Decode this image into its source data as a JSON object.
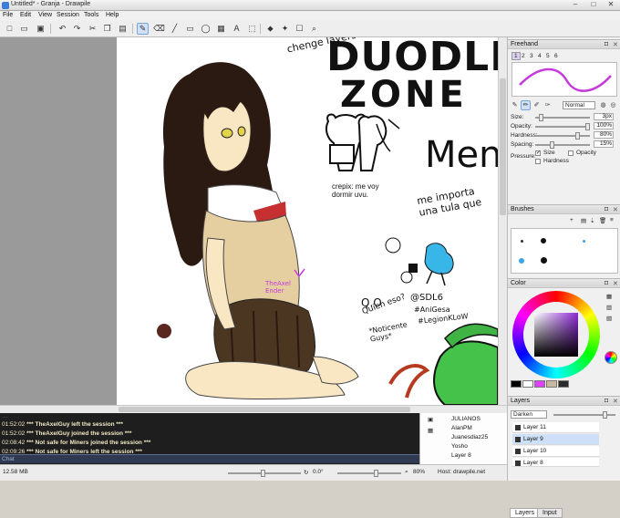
{
  "window": {
    "title": "Untitled* - Granja - Drawpile",
    "controls": [
      "–",
      "□",
      "✕"
    ]
  },
  "menu": [
    "File",
    "Edit",
    "View",
    "Session",
    "Tools",
    "Help"
  ],
  "canvas_text": {
    "dudles": "DUODLES",
    "zone": "ZONE",
    "change_layers": "chenge layers?",
    "crepix": "crepix: me voy\ndormir uvu.",
    "me": "Men",
    "me_importa": "me importa\nuna tula que",
    "sdl6": "@SDL6",
    "anigesa": "#AniGesa",
    "legionklow": "#LegionKLoW",
    "quien_es": "Quien eso?",
    "noticente": "*Noticente\nGuys*",
    "qoo": "Q.O",
    "signature": "TheAxel\nEnder"
  },
  "freehand": {
    "title": "Freehand",
    "presets": [
      "1",
      "2",
      "3",
      "4",
      "5",
      "6"
    ],
    "blend_mode": "Normal",
    "size_label": "Size:",
    "size_value": "3px",
    "opacity_label": "Opacity:",
    "opacity_value": "100%",
    "hardness_label": "Hardness:",
    "hardness_value": "80%",
    "spacing_label": "Spacing:",
    "spacing_value": "15%",
    "pressure_label": "Pressure:",
    "pressure_size": "Size",
    "pressure_opacity": "Opacity",
    "pressure_hardness": "Hardness",
    "stroke_color": "#c43bd9"
  },
  "brushes": {
    "title": "Brushes"
  },
  "color": {
    "title": "Color",
    "current_color": "#5e2a78",
    "swatches": [
      "#000000",
      "#ffffff",
      "#e040fb",
      "#c8b9a0",
      "#2a2a2a"
    ]
  },
  "layers": {
    "title": "Layers",
    "blend_mode": "Darken",
    "items": [
      "Layer 11",
      "Layer 9",
      "Layer 10",
      "Layer 8"
    ],
    "tabs": [
      "Layers",
      "Input"
    ]
  },
  "chat": {
    "lines": [
      {
        "time": "01:52:02",
        "text": "*** TheAxelGuy left the session ***"
      },
      {
        "time": "01:52:02",
        "text": "*** TheAxelGuy joined the session ***"
      },
      {
        "time": "02:08:42",
        "text": "*** Not safe for Miners joined the session ***"
      },
      {
        "time": "02:09:26",
        "text": "*** Not safe for Miners left the session ***"
      }
    ],
    "input_label": "Chat"
  },
  "users": [
    "JULIANOS",
    "AlanPM",
    "Juanesdiaz25",
    "Yosho",
    "Layer 8"
  ],
  "status": {
    "memory": "12.58 MB",
    "rotation": "0.0°",
    "zoom": "80%",
    "host": "Host: drawpile.net"
  }
}
